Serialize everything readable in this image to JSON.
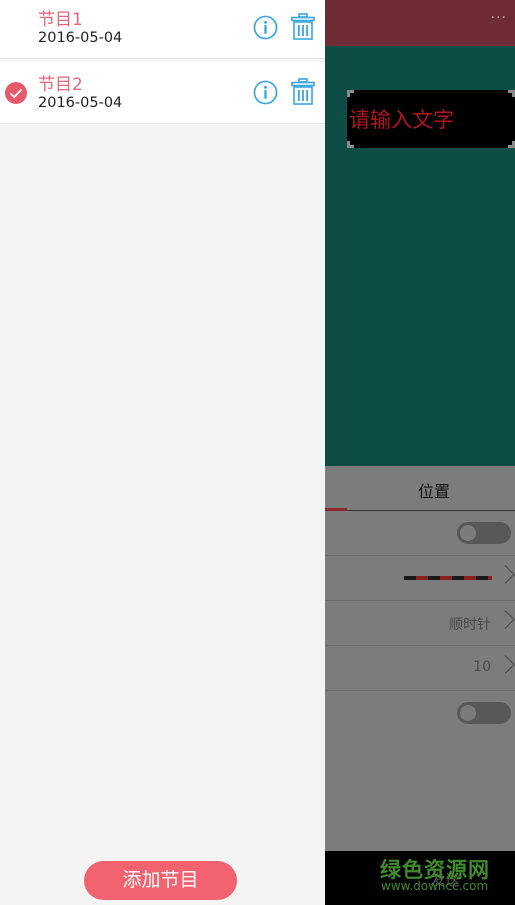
{
  "background": {
    "more_glyph": "···",
    "canvas_text_placeholder": "请输入文字",
    "panel": {
      "tab_label": "位置",
      "rows": [
        {
          "value": ""
        },
        {
          "value": ""
        },
        {
          "value": "顺时针"
        },
        {
          "value": "10"
        },
        {
          "value": ""
        }
      ]
    },
    "bottom": {
      "send_label": "发送"
    },
    "watermark": {
      "line1": "绿色资源网",
      "line2": "www.downcc.com"
    }
  },
  "drawer": {
    "programs": [
      {
        "title": "节目1",
        "date": "2016-05-04",
        "selected": false
      },
      {
        "title": "节目2",
        "date": "2016-05-04",
        "selected": true
      }
    ],
    "add_label": "添加节目"
  },
  "colors": {
    "accent": "#f2626f",
    "title": "#e76679",
    "icon": "#3aa6df"
  }
}
